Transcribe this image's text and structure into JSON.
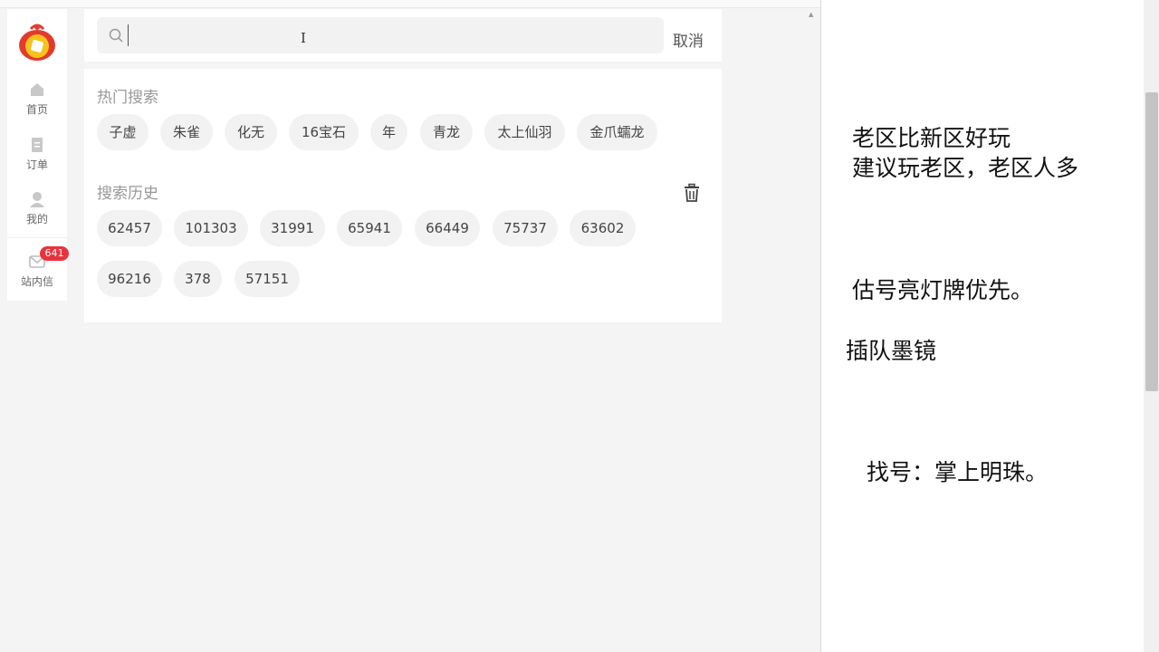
{
  "sidebar": {
    "items": [
      {
        "label": "首页",
        "icon": "home-icon"
      },
      {
        "label": "订单",
        "icon": "orders-icon"
      },
      {
        "label": "我的",
        "icon": "profile-icon"
      },
      {
        "label": "站内信",
        "icon": "mail-icon",
        "badge": "641"
      }
    ],
    "badge_color": "#e8333d"
  },
  "search": {
    "value": "",
    "cancel_label": "取消"
  },
  "hot": {
    "title": "热门搜索",
    "tags": [
      "子虚",
      "朱雀",
      "化无",
      "16宝石",
      "年",
      "青龙",
      "太上仙羽",
      "金爪蠕龙"
    ]
  },
  "history": {
    "title": "搜索历史",
    "items": [
      "62457",
      "101303",
      "31991",
      "65941",
      "66449",
      "75737",
      "63602",
      "96216",
      "378",
      "57151"
    ]
  },
  "notes": {
    "line1": "老区比新区好玩",
    "line2": "建议玩老区，老区人多",
    "line3": "估号亮灯牌优先。",
    "line4": "插队墨镜",
    "line5": "找号：掌上明珠。"
  }
}
